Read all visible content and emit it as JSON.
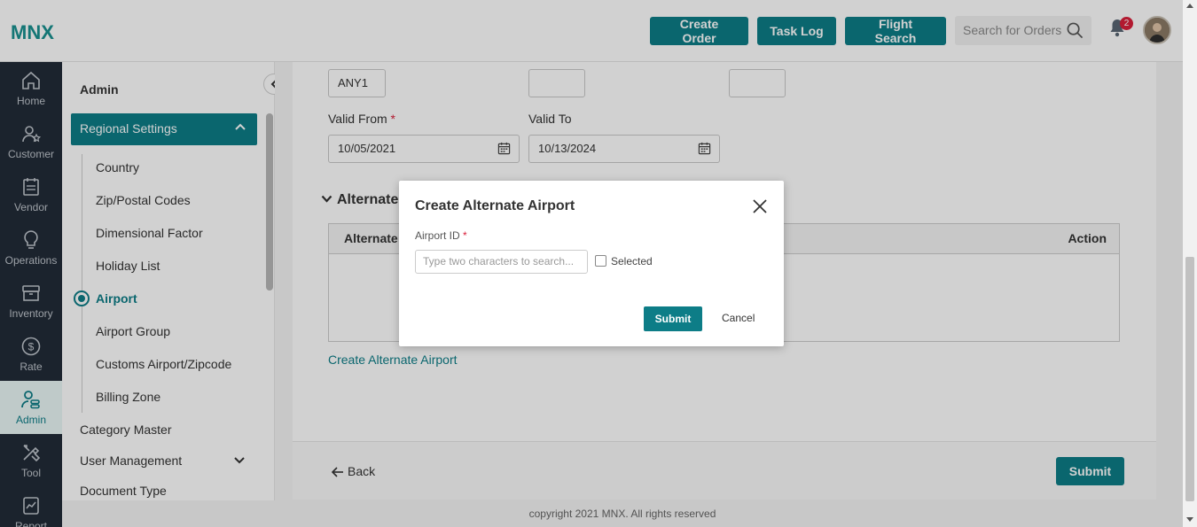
{
  "header": {
    "logo": "MNX",
    "buttons": {
      "create_order": "Create Order",
      "task_log": "Task Log",
      "flight_search": "Flight Search"
    },
    "search_placeholder": "Search for Orders",
    "notification_count": "2"
  },
  "rail": {
    "items": [
      {
        "label": "Home",
        "icon": "home-icon"
      },
      {
        "label": "Customer",
        "icon": "customer-icon"
      },
      {
        "label": "Vendor",
        "icon": "vendor-icon"
      },
      {
        "label": "Operations",
        "icon": "bulb-icon"
      },
      {
        "label": "Inventory",
        "icon": "inventory-icon"
      },
      {
        "label": "Rate",
        "icon": "dollar-icon"
      },
      {
        "label": "Admin",
        "icon": "admin-icon"
      },
      {
        "label": "Tool",
        "icon": "tool-icon"
      },
      {
        "label": "Report",
        "icon": "report-icon"
      }
    ],
    "active": "Admin"
  },
  "sidepanel": {
    "title": "Admin",
    "regional_settings": "Regional Settings",
    "sub_items": [
      "Country",
      "Zip/Postal Codes",
      "Dimensional Factor",
      "Holiday List",
      "Airport",
      "Airport Group",
      "Customs Airport/Zipcode",
      "Billing Zone"
    ],
    "active_sub": "Airport",
    "top_items": [
      "Category Master",
      "User Management",
      "Document Type"
    ]
  },
  "form": {
    "field1_value": "ANY1",
    "valid_from_label": "Valid From",
    "valid_from_value": "10/05/2021",
    "valid_to_label": "Valid To",
    "valid_to_value": "10/13/2024",
    "required_mark": "*"
  },
  "alternate_section": {
    "title": "Alternate",
    "col_alternate": "Alternate",
    "col_action": "Action",
    "create_link": "Create Alternate Airport"
  },
  "footer": {
    "back": "Back",
    "submit": "Submit",
    "copyright": "copyright 2021 MNX. All rights reserved"
  },
  "modal": {
    "title": "Create Alternate Airport",
    "airport_id_label": "Airport ID",
    "airport_id_placeholder": "Type two characters to search...",
    "selected_label": "Selected",
    "submit": "Submit",
    "cancel": "Cancel"
  },
  "colors": {
    "accent": "#0d7d87",
    "rail_bg": "#222b37",
    "required": "#d9203b"
  }
}
